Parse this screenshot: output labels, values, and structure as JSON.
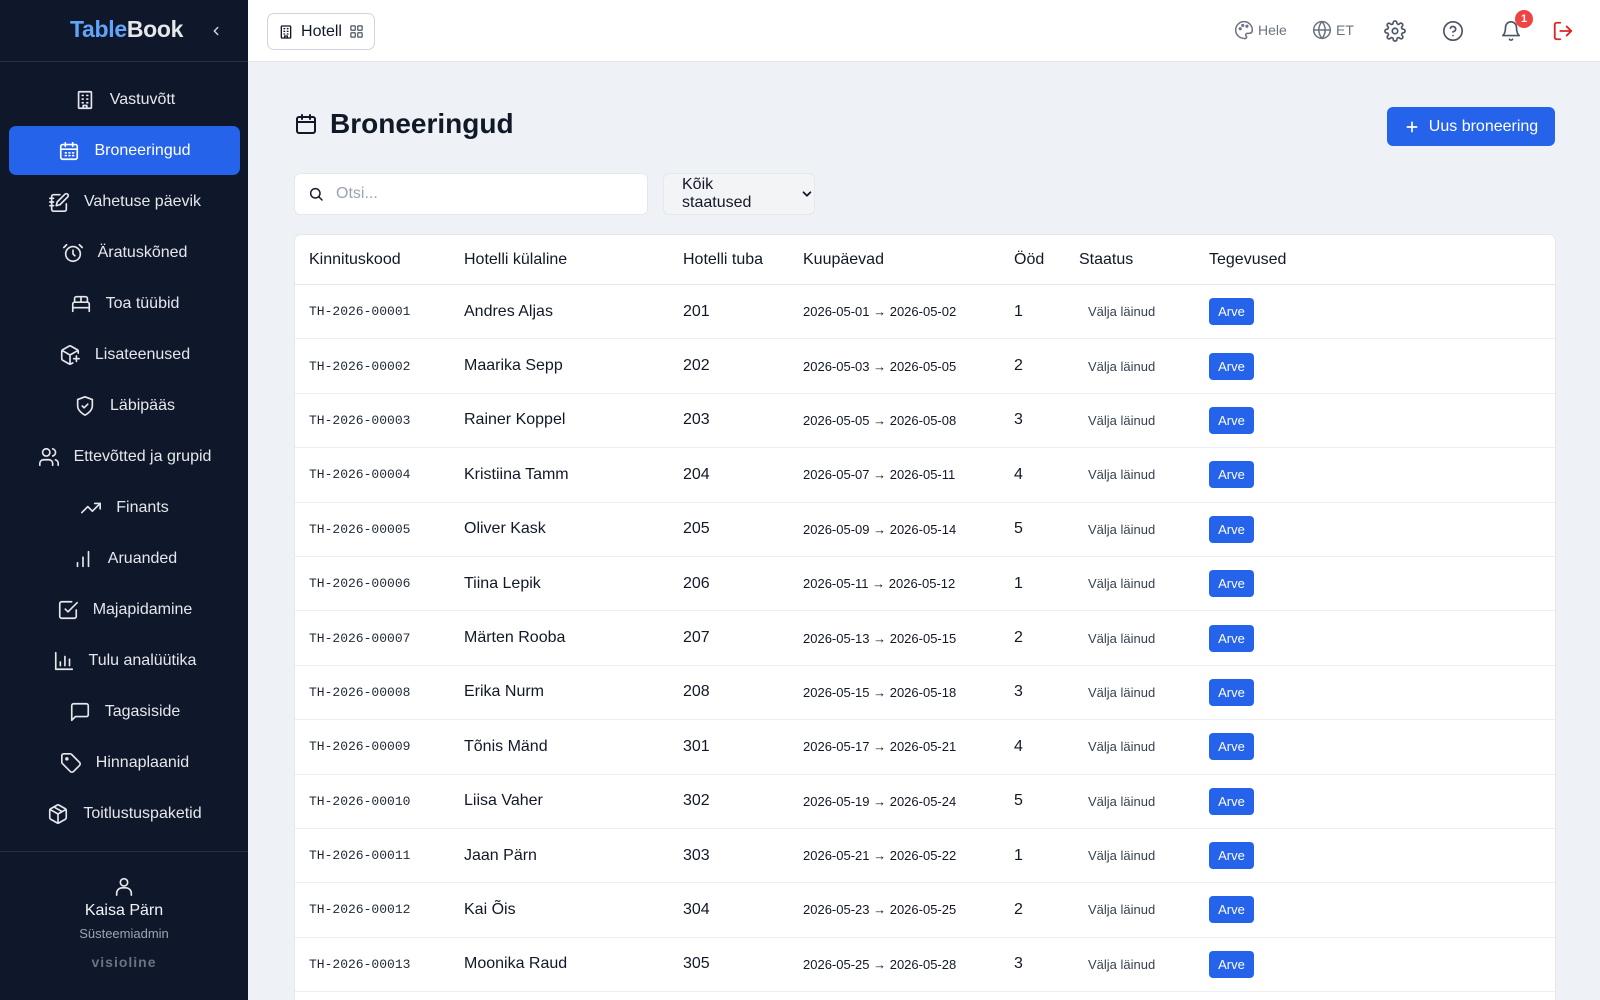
{
  "app": {
    "brand_part1": "Table",
    "brand_part2": "Book"
  },
  "sidebar": {
    "items": [
      {
        "label": "Vastuvõtt",
        "icon": "building-icon"
      },
      {
        "label": "Broneeringud",
        "icon": "calendar-icon",
        "active": true
      },
      {
        "label": "Vahetuse päevik",
        "icon": "notebook-pen-icon"
      },
      {
        "label": "Äratuskõned",
        "icon": "alarm-clock-icon"
      },
      {
        "label": "Toa tüübid",
        "icon": "bed-icon"
      },
      {
        "label": "Lisateenused",
        "icon": "package-plus-icon"
      },
      {
        "label": "Läbipääs",
        "icon": "shield-check-icon"
      },
      {
        "label": "Ettevõtted ja grupid",
        "icon": "users-icon"
      },
      {
        "label": "Finants",
        "icon": "trending-up-icon"
      },
      {
        "label": "Aruanded",
        "icon": "bar-chart-icon"
      },
      {
        "label": "Majapidamine",
        "icon": "check-square-icon"
      },
      {
        "label": "Tulu analüütika",
        "icon": "chart-column-icon"
      },
      {
        "label": "Tagasiside",
        "icon": "message-square-icon"
      },
      {
        "label": "Hinnaplaanid",
        "icon": "tag-icon"
      },
      {
        "label": "Toitlustuspaketid",
        "icon": "package-icon"
      }
    ],
    "user": {
      "name": "Kaisa Pärn",
      "role": "Süsteemiadmin"
    },
    "footer_brand": "visioline"
  },
  "topbar": {
    "module_label": "Hotell",
    "theme_label": "Hele",
    "language_label": "ET",
    "notification_count": "1"
  },
  "page": {
    "title": "Broneeringud",
    "new_button_label": "Uus broneering",
    "search_placeholder": "Otsi...",
    "status_filter_value": "Kõik staatused"
  },
  "table": {
    "columns": [
      "Kinnituskood",
      "Hotelli külaline",
      "Hotelli tuba",
      "Kuupäevad",
      "Ööd",
      "Staatus",
      "Tegevused"
    ],
    "action_label": "Arve",
    "rows": [
      {
        "code": "TH-2026-00001",
        "guest": "Andres Aljas",
        "room": "201",
        "dates": "2026-05-01 → 2026-05-02",
        "nights": "1",
        "status": "Välja läinud"
      },
      {
        "code": "TH-2026-00002",
        "guest": "Maarika Sepp",
        "room": "202",
        "dates": "2026-05-03 → 2026-05-05",
        "nights": "2",
        "status": "Välja läinud"
      },
      {
        "code": "TH-2026-00003",
        "guest": "Rainer Koppel",
        "room": "203",
        "dates": "2026-05-05 → 2026-05-08",
        "nights": "3",
        "status": "Välja läinud"
      },
      {
        "code": "TH-2026-00004",
        "guest": "Kristiina Tamm",
        "room": "204",
        "dates": "2026-05-07 → 2026-05-11",
        "nights": "4",
        "status": "Välja läinud"
      },
      {
        "code": "TH-2026-00005",
        "guest": "Oliver Kask",
        "room": "205",
        "dates": "2026-05-09 → 2026-05-14",
        "nights": "5",
        "status": "Välja läinud"
      },
      {
        "code": "TH-2026-00006",
        "guest": "Tiina Lepik",
        "room": "206",
        "dates": "2026-05-11 → 2026-05-12",
        "nights": "1",
        "status": "Välja läinud"
      },
      {
        "code": "TH-2026-00007",
        "guest": "Märten Rooba",
        "room": "207",
        "dates": "2026-05-13 → 2026-05-15",
        "nights": "2",
        "status": "Välja läinud"
      },
      {
        "code": "TH-2026-00008",
        "guest": "Erika Nurm",
        "room": "208",
        "dates": "2026-05-15 → 2026-05-18",
        "nights": "3",
        "status": "Välja läinud"
      },
      {
        "code": "TH-2026-00009",
        "guest": "Tõnis Mänd",
        "room": "301",
        "dates": "2026-05-17 → 2026-05-21",
        "nights": "4",
        "status": "Välja läinud"
      },
      {
        "code": "TH-2026-00010",
        "guest": "Liisa Vaher",
        "room": "302",
        "dates": "2026-05-19 → 2026-05-24",
        "nights": "5",
        "status": "Välja läinud"
      },
      {
        "code": "TH-2026-00011",
        "guest": "Jaan Pärn",
        "room": "303",
        "dates": "2026-05-21 → 2026-05-22",
        "nights": "1",
        "status": "Välja läinud"
      },
      {
        "code": "TH-2026-00012",
        "guest": "Kai Õis",
        "room": "304",
        "dates": "2026-05-23 → 2026-05-25",
        "nights": "2",
        "status": "Välja läinud"
      },
      {
        "code": "TH-2026-00013",
        "guest": "Moonika Raud",
        "room": "305",
        "dates": "2026-05-25 → 2026-05-28",
        "nights": "3",
        "status": "Välja läinud"
      }
    ]
  },
  "colors": {
    "accent": "#2563eb",
    "sidebar_bg": "#0f172a",
    "badge": "#ef4444",
    "logout": "#dc2626"
  }
}
